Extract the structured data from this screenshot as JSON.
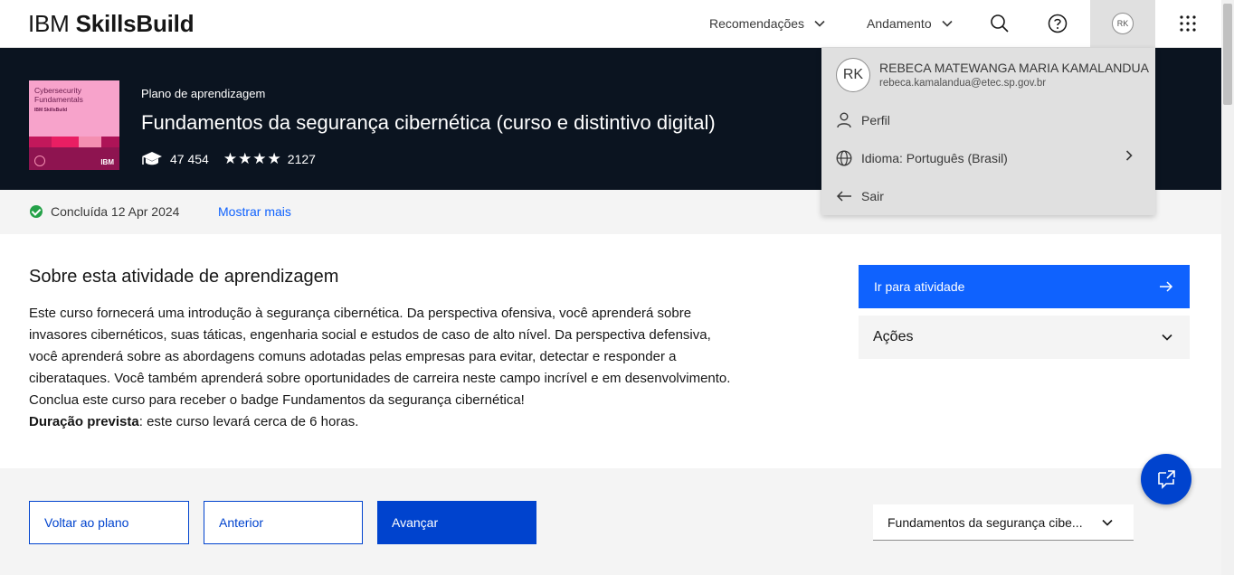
{
  "header": {
    "brand_prefix": "IBM",
    "brand_name": "SkillsBuild",
    "nav": [
      "Recomendações",
      "Andamento"
    ],
    "avatar_initials": "RK"
  },
  "hero": {
    "thumbnail": {
      "title": "Cybersecurity Fundamentals",
      "brand": "IBM SkillsBuild",
      "logo": "IBM"
    },
    "plan_label": "Plano de aprendizagem",
    "title": "Fundamentos da segurança cibernética (curso e distintivo digital)",
    "learners": "47 454",
    "rating_stars": 4,
    "reviews": "2127"
  },
  "status": {
    "completed_text": "Concluída 12 Apr 2024",
    "show_more": "Mostrar mais"
  },
  "about": {
    "title": "Sobre esta atividade de aprendizagem",
    "description": "Este curso fornecerá uma introdução à segurança cibernética. Da perspectiva ofensiva, você aprenderá sobre invasores cibernéticos, suas táticas, engenharia social e estudos de caso de alto nível. Da perspectiva defensiva, você aprenderá sobre as abordagens comuns adotadas pelas empresas para evitar, detectar e responder a ciberataques. Você também aprenderá sobre oportunidades de carreira neste campo incrível e em desenvolvimento.",
    "badge_text": "Conclua este curso para receber o badge Fundamentos da segurança cibernética!",
    "duration_label": "Duração prevista",
    "duration_text": ": este curso levará cerca de 6 horas."
  },
  "sidebar": {
    "go_button": "Ir para atividade",
    "actions": "Ações"
  },
  "footer_nav": {
    "back": "Voltar ao plano",
    "previous": "Anterior",
    "next": "Avançar",
    "select_value": "Fundamentos da segurança cibe..."
  },
  "profile_menu": {
    "initials": "RK",
    "name": "REBECA MATEWANGA MARIA KAMALANDUA",
    "email": "rebeca.kamalandua@etec.sp.gov.br",
    "profile": "Perfil",
    "language": "Idioma: Português (Brasil)",
    "logout": "Sair"
  },
  "colors": {
    "primary": "#0f62fe",
    "primary_dark": "#0043ce",
    "hero_bg": "#0b1420",
    "success": "#24a148",
    "menu_bg": "#e0e0e0"
  }
}
